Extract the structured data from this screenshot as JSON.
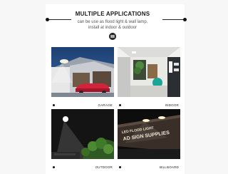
{
  "header": {
    "title": "MULTIPLE APPLICATIONS",
    "subtitle_line1": "can be use as flood light & wall lamp,",
    "subtitle_line2": "install at indoor & outdoor",
    "logo_icon": "brand-logo-icon"
  },
  "applications": [
    {
      "label": "GARAGE",
      "image": "garage-scene"
    },
    {
      "label": "INDOOR",
      "image": "indoor-scene"
    },
    {
      "label": "OUTDOOR",
      "image": "outdoor-scene"
    },
    {
      "label": "BILLBOARD",
      "image": "billboard-scene"
    }
  ],
  "billboard_text": {
    "line1": "LED FLOOD LIGHT",
    "line2": "AD SIGN SUPPLIES"
  }
}
